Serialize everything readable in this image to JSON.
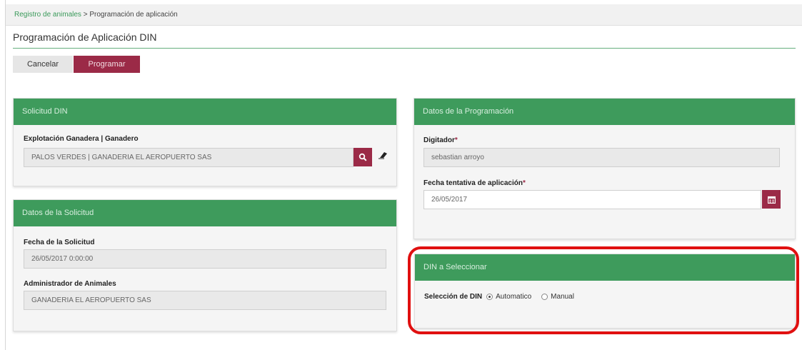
{
  "breadcrumb": {
    "link": "Registro de animales",
    "separator": " > ",
    "current": "Programación de aplicación"
  },
  "page": {
    "title": "Programación de Aplicación DIN"
  },
  "actions": {
    "cancel": "Cancelar",
    "submit": "Programar"
  },
  "solicitud_din": {
    "header": "Solicitud DIN",
    "explotacion_label": "Explotación Ganadera | Ganadero",
    "explotacion_value": "PALOS VERDES | GANADERIA EL AEROPUERTO SAS"
  },
  "datos_solicitud": {
    "header": "Datos de la Solicitud",
    "fecha_label": "Fecha de la Solicitud",
    "fecha_value": "26/05/2017 0:00:00",
    "admin_label": "Administrador de Animales",
    "admin_value": "GANADERIA EL AEROPUERTO SAS"
  },
  "datos_programacion": {
    "header": "Datos de la Programación",
    "digitador_label": "Digitador",
    "digitador_value": "sebastian arroyo",
    "fecha_label": "Fecha tentativa de aplicación",
    "fecha_value": "26/05/2017",
    "required_mark": "*"
  },
  "din_seleccionar": {
    "header": "DIN a Seleccionar",
    "seleccion_label": "Selección de DIN",
    "option_auto": "Automatico",
    "option_manual": "Manual",
    "selected": "Automatico"
  },
  "colors": {
    "green": "#3e9b5c",
    "maroon": "#9b2a47",
    "highlight": "#e01010"
  }
}
